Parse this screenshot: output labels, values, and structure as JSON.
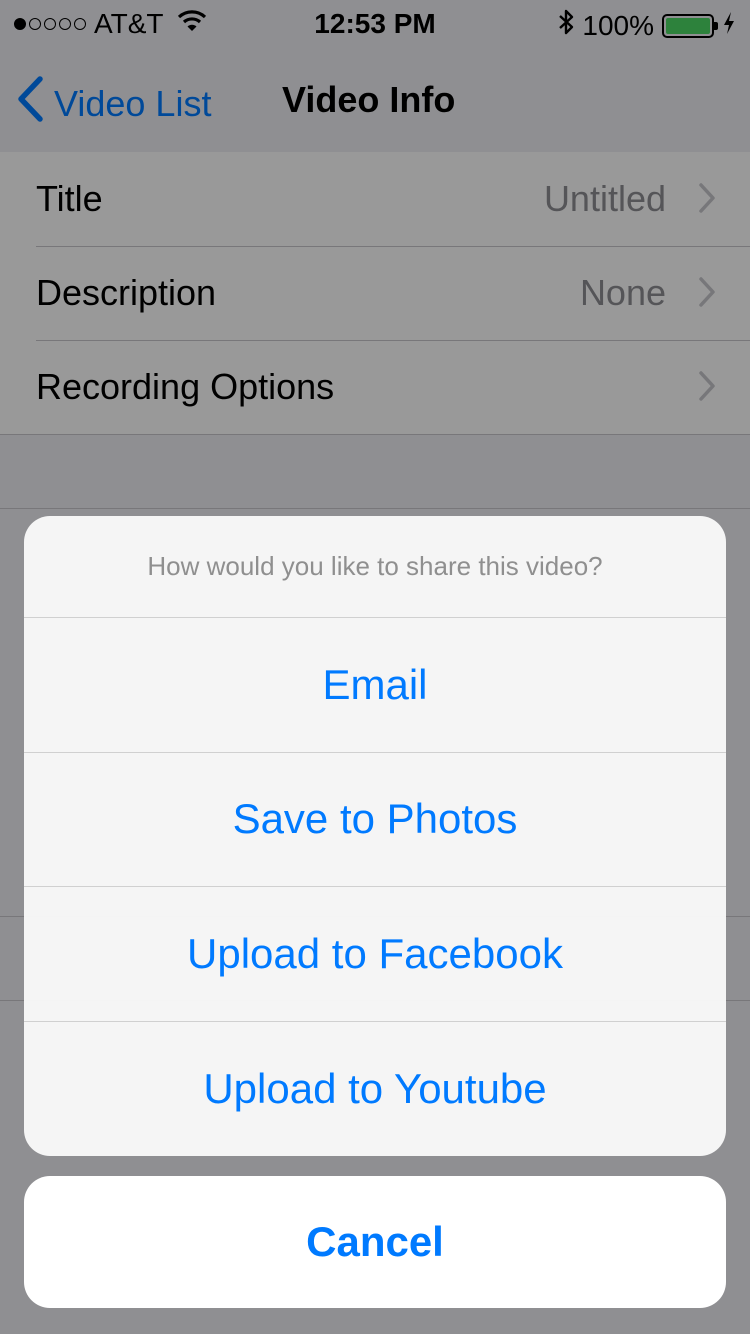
{
  "status_bar": {
    "carrier": "AT&T",
    "time": "12:53 PM",
    "battery_percent": "100%",
    "signal_bars_filled": 1,
    "signal_bars_total": 5,
    "battery_level": 1.0,
    "battery_color": "#4cd964"
  },
  "nav": {
    "back_label": "Video List",
    "title": "Video Info"
  },
  "table": {
    "rows": [
      {
        "label": "Title",
        "value": "Untitled"
      },
      {
        "label": "Description",
        "value": "None"
      },
      {
        "label": "Recording Options",
        "value": ""
      }
    ]
  },
  "action_sheet": {
    "title": "How would you like to share this video?",
    "items": [
      "Email",
      "Save to Photos",
      "Upload to Facebook",
      "Upload to Youtube"
    ],
    "cancel_label": "Cancel"
  },
  "colors": {
    "accent": "#007aff",
    "secondary_text": "#8e8e93"
  }
}
